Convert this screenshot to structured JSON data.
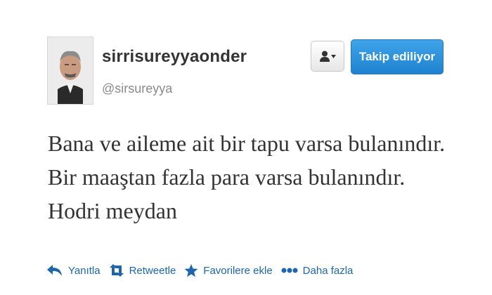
{
  "tweet": {
    "user": {
      "display_name": "sirrisureyyaonder",
      "screen_name": "@sirsureyya",
      "avatar": "profile-photo"
    },
    "follow_button_label": "Takip ediliyor",
    "user_menu_icon": "user-dropdown-icon",
    "text": "Bana ve aileme ait bir tapu varsa bulanındır.\nBir maaştan fazla para varsa bulanındır.\nHodri meydan",
    "actions": [
      {
        "label": "Yanıtla",
        "icon": "reply-icon"
      },
      {
        "label": "Retweetle",
        "icon": "retweet-icon"
      },
      {
        "label": "Favorilere ekle",
        "icon": "star-icon"
      },
      {
        "label": "Daha fazla",
        "icon": "more-dots-icon"
      }
    ]
  },
  "colors": {
    "link": "#1d66ad",
    "follow_button": "#2f95df",
    "text": "#333333",
    "muted": "#8a8a8a"
  }
}
